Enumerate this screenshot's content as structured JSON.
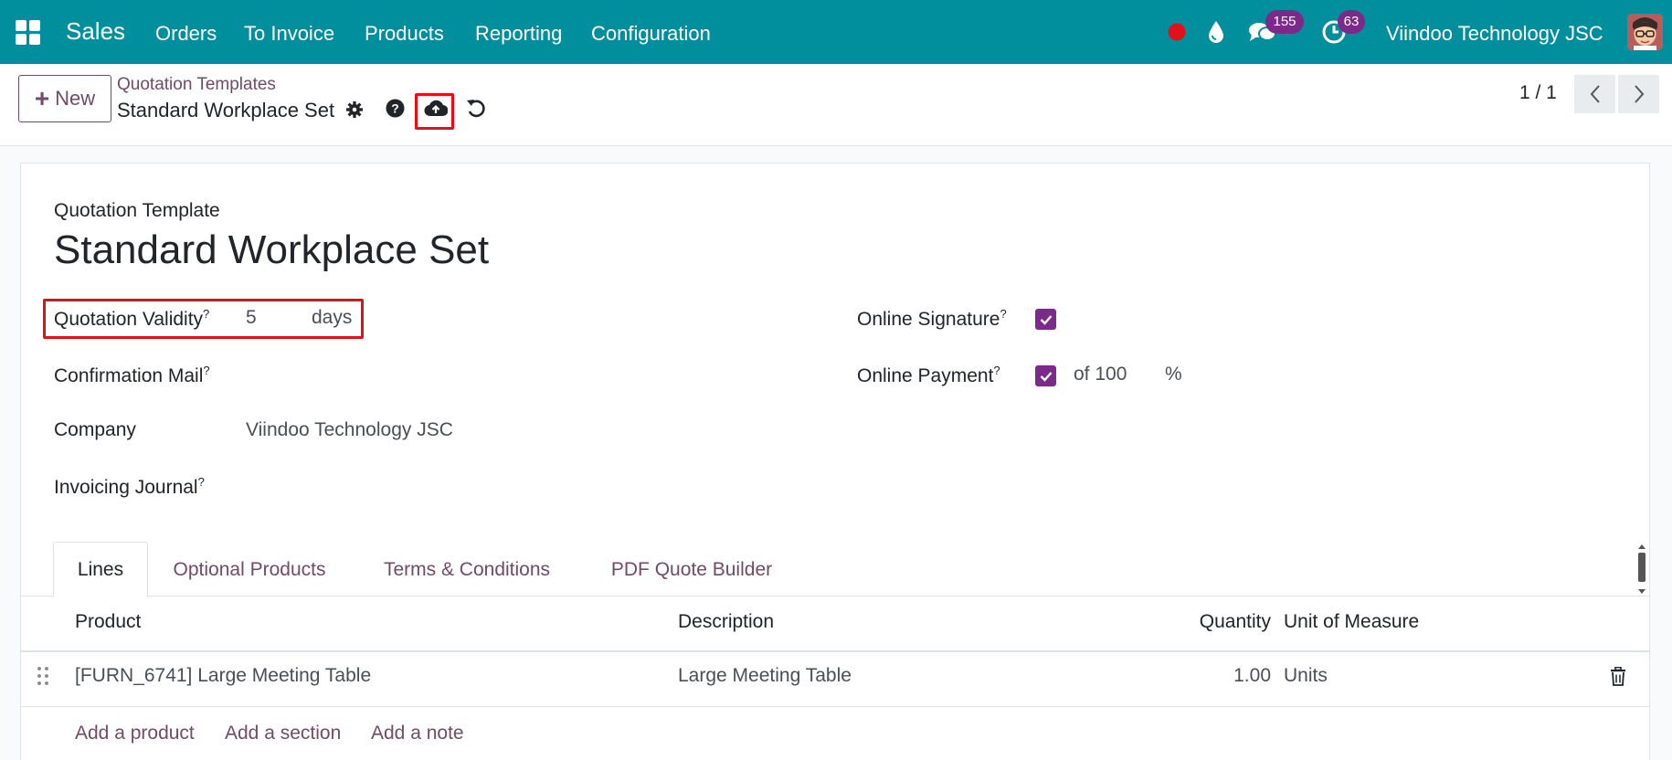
{
  "navbar": {
    "app_name": "Sales",
    "menus": [
      "Orders",
      "To Invoice",
      "Products",
      "Reporting",
      "Configuration"
    ],
    "messages_count": "155",
    "activities_count": "63",
    "company": "Viindoo Technology JSC",
    "icons": [
      "apps-grid-icon",
      "status-dot-icon",
      "droplet-icon",
      "chat-icon",
      "clock-icon",
      "avatar"
    ]
  },
  "control_panel": {
    "new_label": "New",
    "breadcrumb": "Quotation Templates",
    "record_name": "Standard Workplace Set",
    "pager": "1 / 1"
  },
  "form": {
    "subtitle": "Quotation Template",
    "title": "Standard Workplace Set",
    "fields": {
      "validity_label": "Quotation Validity",
      "validity_value": "5",
      "validity_unit": "days",
      "mail_label": "Confirmation Mail",
      "company_label": "Company",
      "company_value": "Viindoo Technology JSC",
      "journal_label": "Invoicing Journal",
      "signature_label": "Online Signature",
      "signature_checked": true,
      "payment_label": "Online Payment",
      "payment_checked": true,
      "payment_of": "of 100",
      "payment_unit": "%",
      "help_mark": "?"
    }
  },
  "tabs": [
    "Lines",
    "Optional Products",
    "Terms & Conditions",
    "PDF Quote Builder"
  ],
  "table": {
    "headers": [
      "Product",
      "Description",
      "Quantity",
      "Unit of Measure"
    ],
    "rows": [
      {
        "product": "[FURN_6741] Large Meeting Table",
        "description": "Large Meeting Table",
        "quantity": "1.00",
        "uom": "Units"
      }
    ],
    "actions": [
      "Add a product",
      "Add a section",
      "Add a note"
    ]
  },
  "colors": {
    "navbar": "#018f9d",
    "brand": "#714b67",
    "checkbox": "#7c2a8a",
    "highlight": "#e3101a"
  }
}
